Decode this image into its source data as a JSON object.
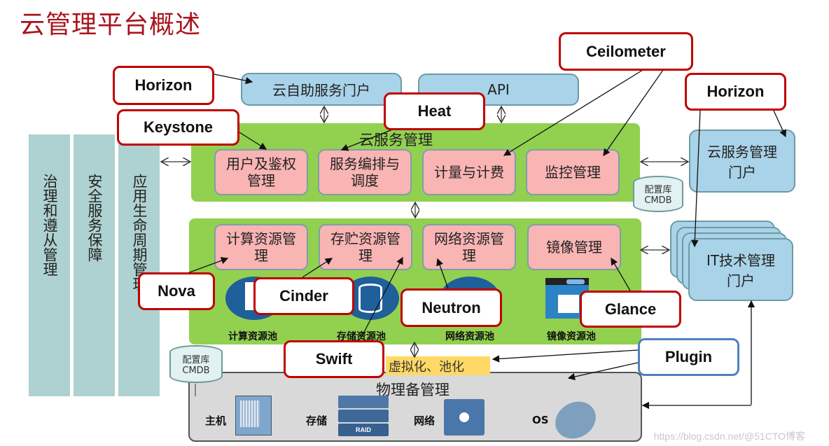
{
  "title": "云管理平台概述",
  "side_columns": [
    {
      "label": "治理和遵从管理"
    },
    {
      "label": "安全服务保障"
    },
    {
      "label": "应用生命周期管理"
    }
  ],
  "top_portals": {
    "self_service": "云自助服务门户",
    "api": "API"
  },
  "cloud_service_mgmt": {
    "title": "云服务管理",
    "modules": [
      "用户及鉴权管理",
      "服务编排与调度",
      "计量与计费",
      "监控管理"
    ]
  },
  "resource_mgmt": {
    "modules": [
      "计算资源管理",
      "存贮资源管理",
      "网络资源管理",
      "镜像管理"
    ],
    "pools": [
      "计算资源池",
      "存储资源池",
      "网络资源池",
      "镜像资源池"
    ]
  },
  "right_portals": {
    "cloud_service_portal": "云服务管理门户",
    "it_portal": "IT技术管理门户"
  },
  "cmdb": {
    "line1": "配置库",
    "line2": "CMDB"
  },
  "virtualization": "虚拟化、池化",
  "physical": {
    "title": "物理备管理",
    "items": [
      "主机",
      "存储",
      "网络",
      "OS"
    ],
    "raid_label": "RAID"
  },
  "openstack_tags": {
    "horizon_left": "Horizon",
    "keystone": "Keystone",
    "heat": "Heat",
    "ceilometer": "Ceilometer",
    "horizon_right": "Horizon",
    "nova": "Nova",
    "cinder": "Cinder",
    "neutron": "Neutron",
    "glance": "Glance",
    "swift": "Swift",
    "plugin": "Plugin"
  },
  "watermark": "https://blog.csdn.net/@51CTO博客",
  "colors": {
    "title_red": "#a8141e",
    "tag_border_red": "#c00000",
    "tag_border_blue": "#4f81bd",
    "green": "#92d050",
    "pink": "#f9b4b4",
    "light_blue": "#a9d3e8",
    "teal_column": "#aed1d1",
    "yellow": "#ffd965",
    "gray": "#d9d9d9"
  }
}
